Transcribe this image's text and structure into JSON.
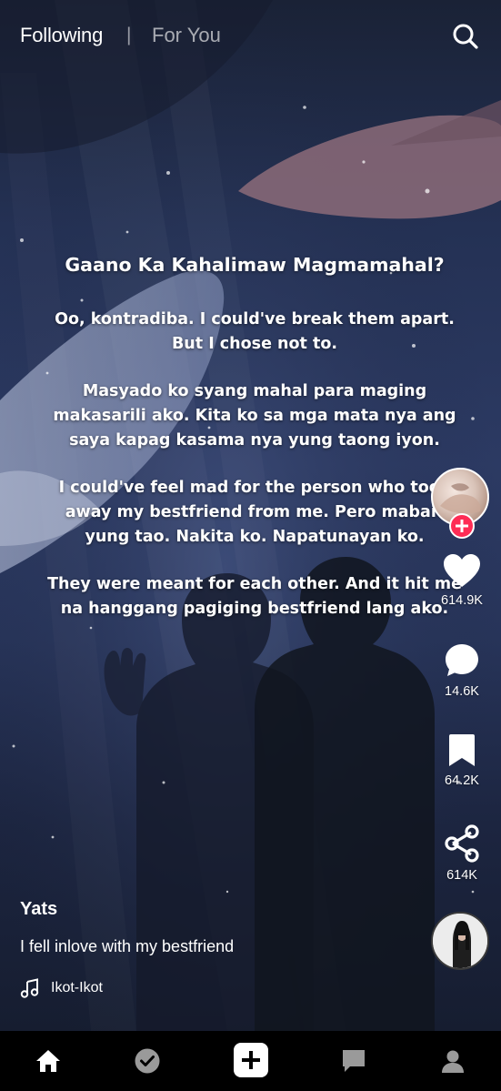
{
  "top_bar": {
    "following_label": "Following",
    "divider": "|",
    "for_you_label": "For You",
    "search_icon": "search-icon"
  },
  "post": {
    "title": "Gaano Ka Kahalimaw Magmamahal?",
    "paragraphs": [
      "Oo, kontradiba. I could've break them apart. But I chose not to.",
      "Masyado ko syang mahal para maging makasarili ako. Kita ko sa mga mata nya ang saya kapag kasama nya yung taong iyon.",
      "I could've feel mad for the person who took away my bestfriend from me. Pero mabait yung tao. Nakita ko. Napatunayan ko.",
      "They were meant for each other. And it hit me na hanggang pagiging bestfriend lang ako."
    ]
  },
  "rail": {
    "follow_icon": "plus-icon",
    "likes": "614.9K",
    "comments": "14.6K",
    "saves": "64.2K",
    "shares": "614K"
  },
  "info": {
    "username": "Yats",
    "description": "I fell inlove with my bestfriend",
    "sound": "Ikot-Ikot"
  },
  "bottom_nav": {
    "items": [
      "home-icon",
      "friends-check-icon",
      "create-plus-icon",
      "inbox-icon",
      "profile-icon"
    ]
  },
  "colors": {
    "accent": "#fe2c55",
    "nav_background": "#000000"
  }
}
